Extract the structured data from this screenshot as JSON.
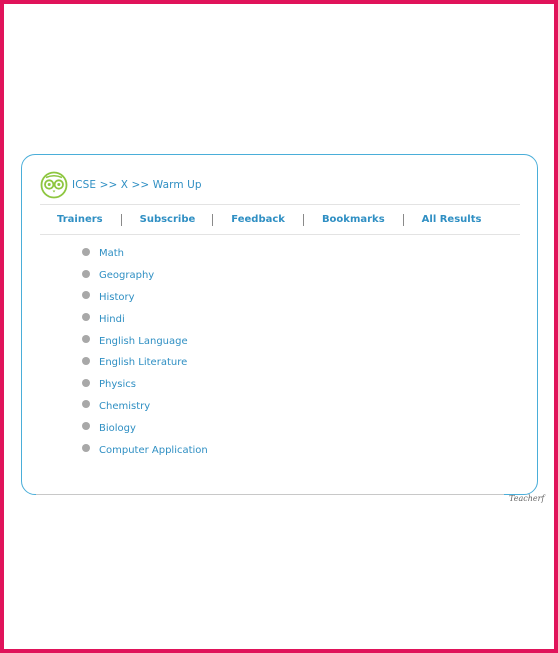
{
  "breadcrumb": "ICSE >> X >> Warm Up",
  "logo": {
    "icon": "owl-logo-icon",
    "color": "#8dc63f"
  },
  "nav": {
    "items": [
      {
        "label": "Trainers"
      },
      {
        "label": "Subscribe"
      },
      {
        "label": "Feedback"
      },
      {
        "label": "Bookmarks"
      },
      {
        "label": "All Results"
      }
    ]
  },
  "subjects": [
    {
      "label": "Math"
    },
    {
      "label": "Geography"
    },
    {
      "label": "History"
    },
    {
      "label": "Hindi"
    },
    {
      "label": "English Language"
    },
    {
      "label": "English Literature"
    },
    {
      "label": "Physics"
    },
    {
      "label": "Chemistry"
    },
    {
      "label": "Biology"
    },
    {
      "label": "Computer Application"
    }
  ],
  "footer": {
    "right_text": "Teacherf"
  },
  "colors": {
    "accent": "#2f8fc3",
    "border": "#4aaed9",
    "frame": "#e0135a"
  }
}
